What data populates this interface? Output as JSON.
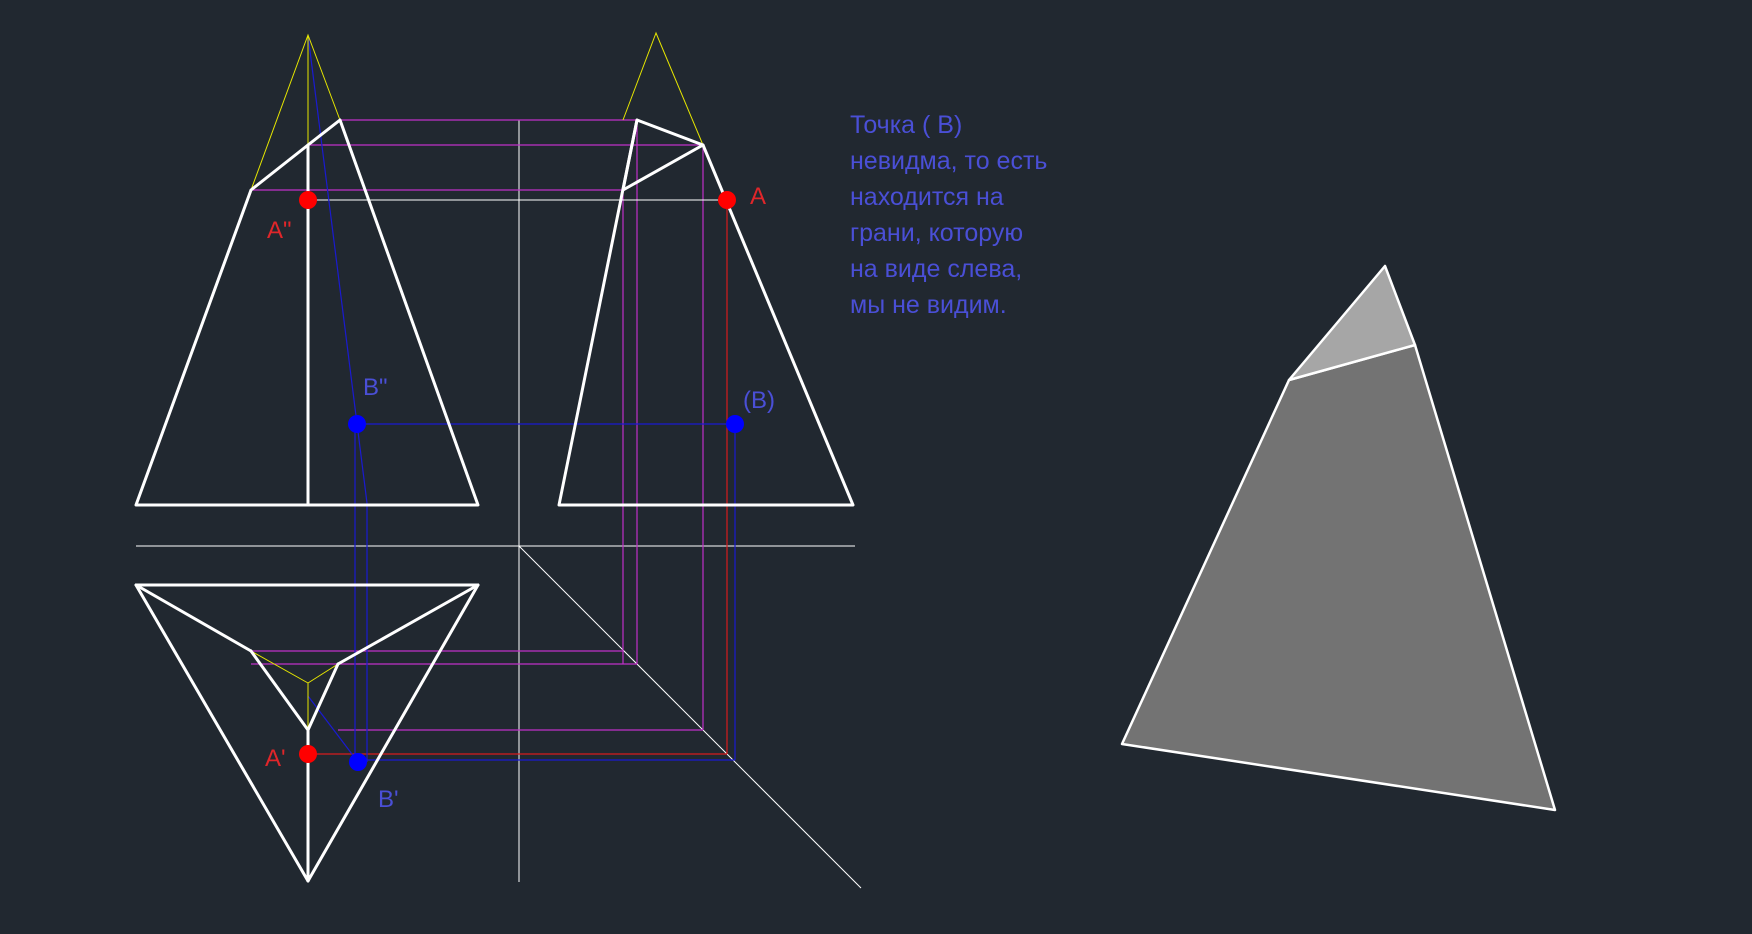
{
  "labels": {
    "a_front": "A\"",
    "a_side": "A",
    "a_top": "A'",
    "b_front": "B\"",
    "b_side": "(B)",
    "b_top": "B'"
  },
  "note": {
    "lines": [
      "Точка  ( B)",
      "невидма, то есть",
      "находится на",
      "грани, которую",
      "на виде слева,",
      "мы не видим."
    ]
  },
  "colors": {
    "background": "#212830",
    "outline": "#ffffff",
    "construction_yellow": "#e6e600",
    "construction_magenta": "#c030c8",
    "point_a": "#ff0000",
    "point_b": "#0000ff",
    "text_blue": "#4a4fd6",
    "face_dark": "#737373",
    "face_light": "#a6a6a6"
  }
}
